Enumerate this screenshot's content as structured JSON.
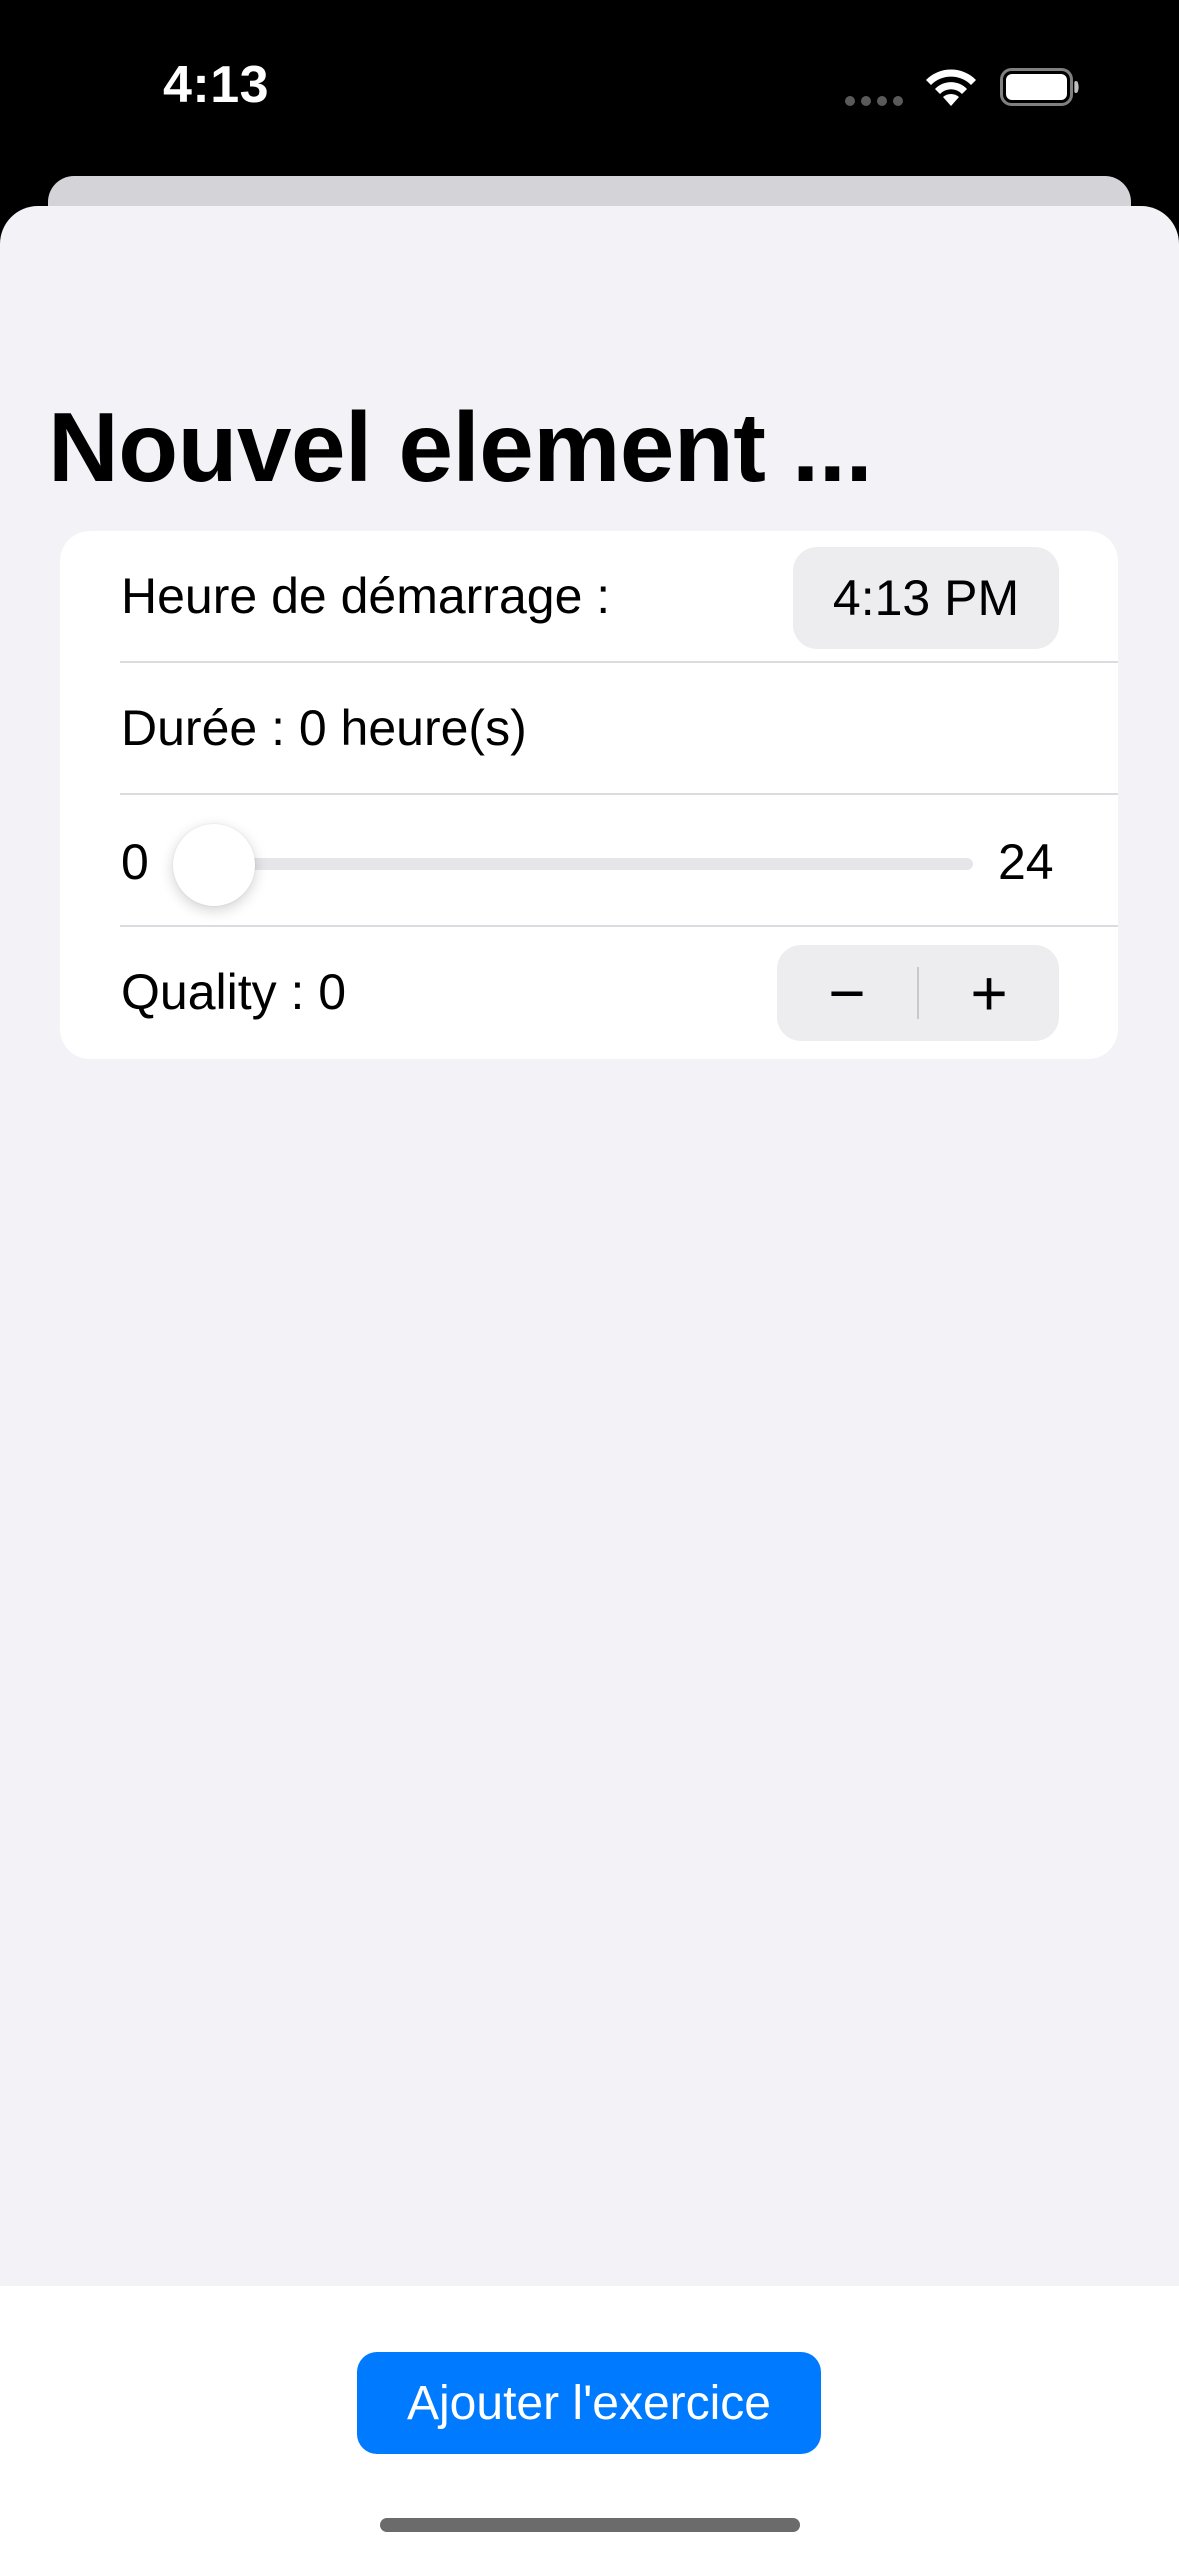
{
  "status_bar": {
    "time": "4:13",
    "icons": [
      "signal-dots-icon",
      "wifi-icon",
      "battery-icon"
    ]
  },
  "page": {
    "title": "Nouvel element ..."
  },
  "form": {
    "start_time": {
      "label": "Heure de démarrage :",
      "value": "4:13 PM"
    },
    "duration": {
      "label": "Durée : 0 heure(s)"
    },
    "slider": {
      "min_label": "0",
      "max_label": "24",
      "min": 0,
      "max": 24,
      "value": 0
    },
    "quality": {
      "label": "Quality : 0",
      "decrement": "−",
      "increment": "+"
    }
  },
  "footer": {
    "primary_button": "Ajouter l'exercice"
  },
  "colors": {
    "accent": "#007aff",
    "sheet_background": "#f2f2f7",
    "card_background": "#ffffff"
  }
}
